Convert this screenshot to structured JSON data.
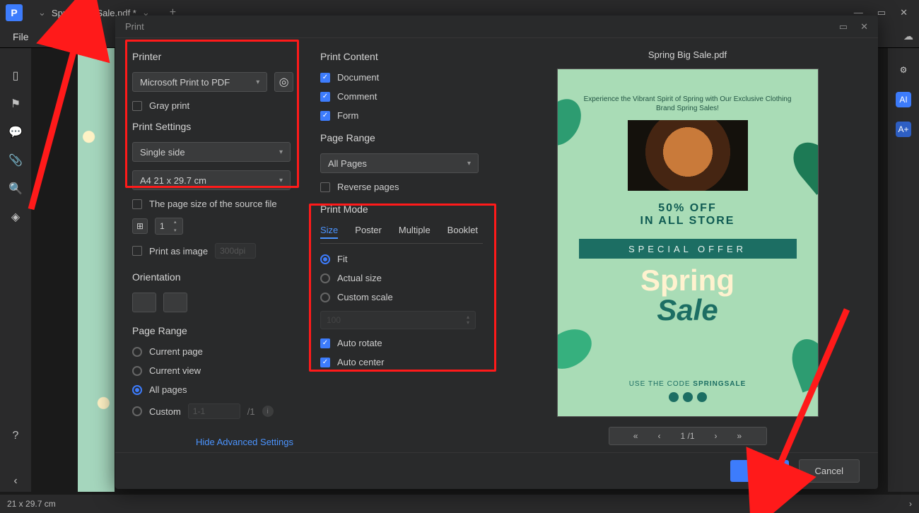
{
  "titlebar": {
    "doc_name": "Spring Big Sale.pdf *"
  },
  "toolbar": {
    "file_label": "File"
  },
  "statusbar": {
    "page_size": "21 x 29.7 cm"
  },
  "dialog": {
    "title": "Print",
    "left": {
      "printer_heading": "Printer",
      "printer_select": "Microsoft Print to PDF",
      "gray_print": "Gray print",
      "print_settings_heading": "Print Settings",
      "sides_select": "Single side",
      "paper_select": "A4 21 x 29.7 cm",
      "source_size": "The page size of the source file",
      "copies_value": "1",
      "print_as_image": "Print as image",
      "dpi_value": "300dpi",
      "orientation_heading": "Orientation",
      "page_range_heading": "Page Range",
      "range_current_page": "Current page",
      "range_current_view": "Current view",
      "range_all_pages": "All pages",
      "range_custom": "Custom",
      "range_custom_value": "1-1",
      "range_total": "/1",
      "advanced_link": "Hide Advanced Settings"
    },
    "mid": {
      "print_content_heading": "Print Content",
      "cb_document": "Document",
      "cb_comment": "Comment",
      "cb_form": "Form",
      "page_range_heading": "Page Range",
      "page_range_select": "All Pages",
      "reverse_pages": "Reverse pages",
      "print_mode_heading": "Print Mode",
      "tabs": {
        "size": "Size",
        "poster": "Poster",
        "multiple": "Multiple",
        "booklet": "Booklet"
      },
      "fit": "Fit",
      "actual": "Actual size",
      "custom_scale": "Custom scale",
      "scale_value": "100",
      "auto_rotate": "Auto rotate",
      "auto_center": "Auto center"
    },
    "right": {
      "preview_title": "Spring Big Sale.pdf",
      "preview": {
        "tagline": "Experience the Vibrant Spirit of Spring with Our Exclusive Clothing Brand Spring Sales!",
        "discount1": "50% OFF",
        "discount2": "IN ALL STORE",
        "banner": "SPECIAL OFFER",
        "spring": "Spring",
        "sale": "Sale",
        "code_prefix": "USE THE CODE ",
        "code": "SPRINGSALE"
      },
      "pager": {
        "current": "1",
        "total": "/1"
      }
    },
    "footer": {
      "print": "Print",
      "cancel": "Cancel"
    }
  }
}
